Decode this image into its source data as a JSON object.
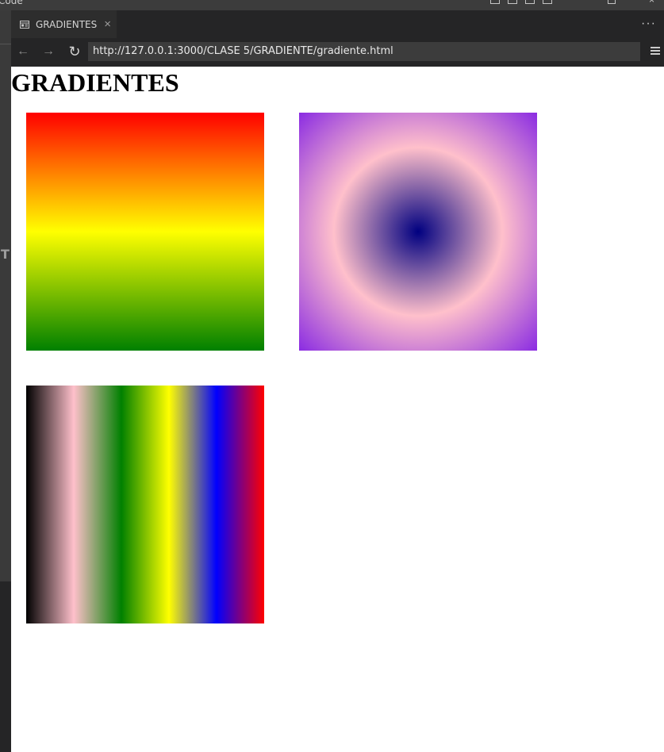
{
  "window": {
    "title_fragment": "Code"
  },
  "tab": {
    "label": "GRADIENTES",
    "close_glyph": "×"
  },
  "tabbar": {
    "more_glyph": "···"
  },
  "nav": {
    "back_glyph": "←",
    "forward_glyph": "→",
    "refresh_glyph": "↻",
    "url": "http://127.0.0.1:3000/CLASE 5/GRADIENTE/gradiente.html"
  },
  "leftstrip": {
    "glyph": "T"
  },
  "page": {
    "title": "GRADIENTES",
    "gradients": [
      {
        "type": "linear-vertical",
        "colors": [
          "#ff0000",
          "#ffff00",
          "#008000"
        ]
      },
      {
        "type": "radial",
        "colors": [
          "#000080",
          "#ffc0cb",
          "#8a2be2"
        ]
      },
      {
        "type": "linear-horizontal",
        "colors": [
          "#000000",
          "#ffc0cb",
          "#008000",
          "#ffff00",
          "#0000ff",
          "#ff0000"
        ]
      }
    ]
  },
  "icons": {
    "tab_icon": "preview-icon",
    "menu_icon": "hamburger-icon"
  },
  "colors": {
    "chrome_bg": "#252526",
    "tab_bg": "#2d2d2d",
    "url_bg": "#3c3c3c",
    "page_bg": "#ffffff"
  }
}
